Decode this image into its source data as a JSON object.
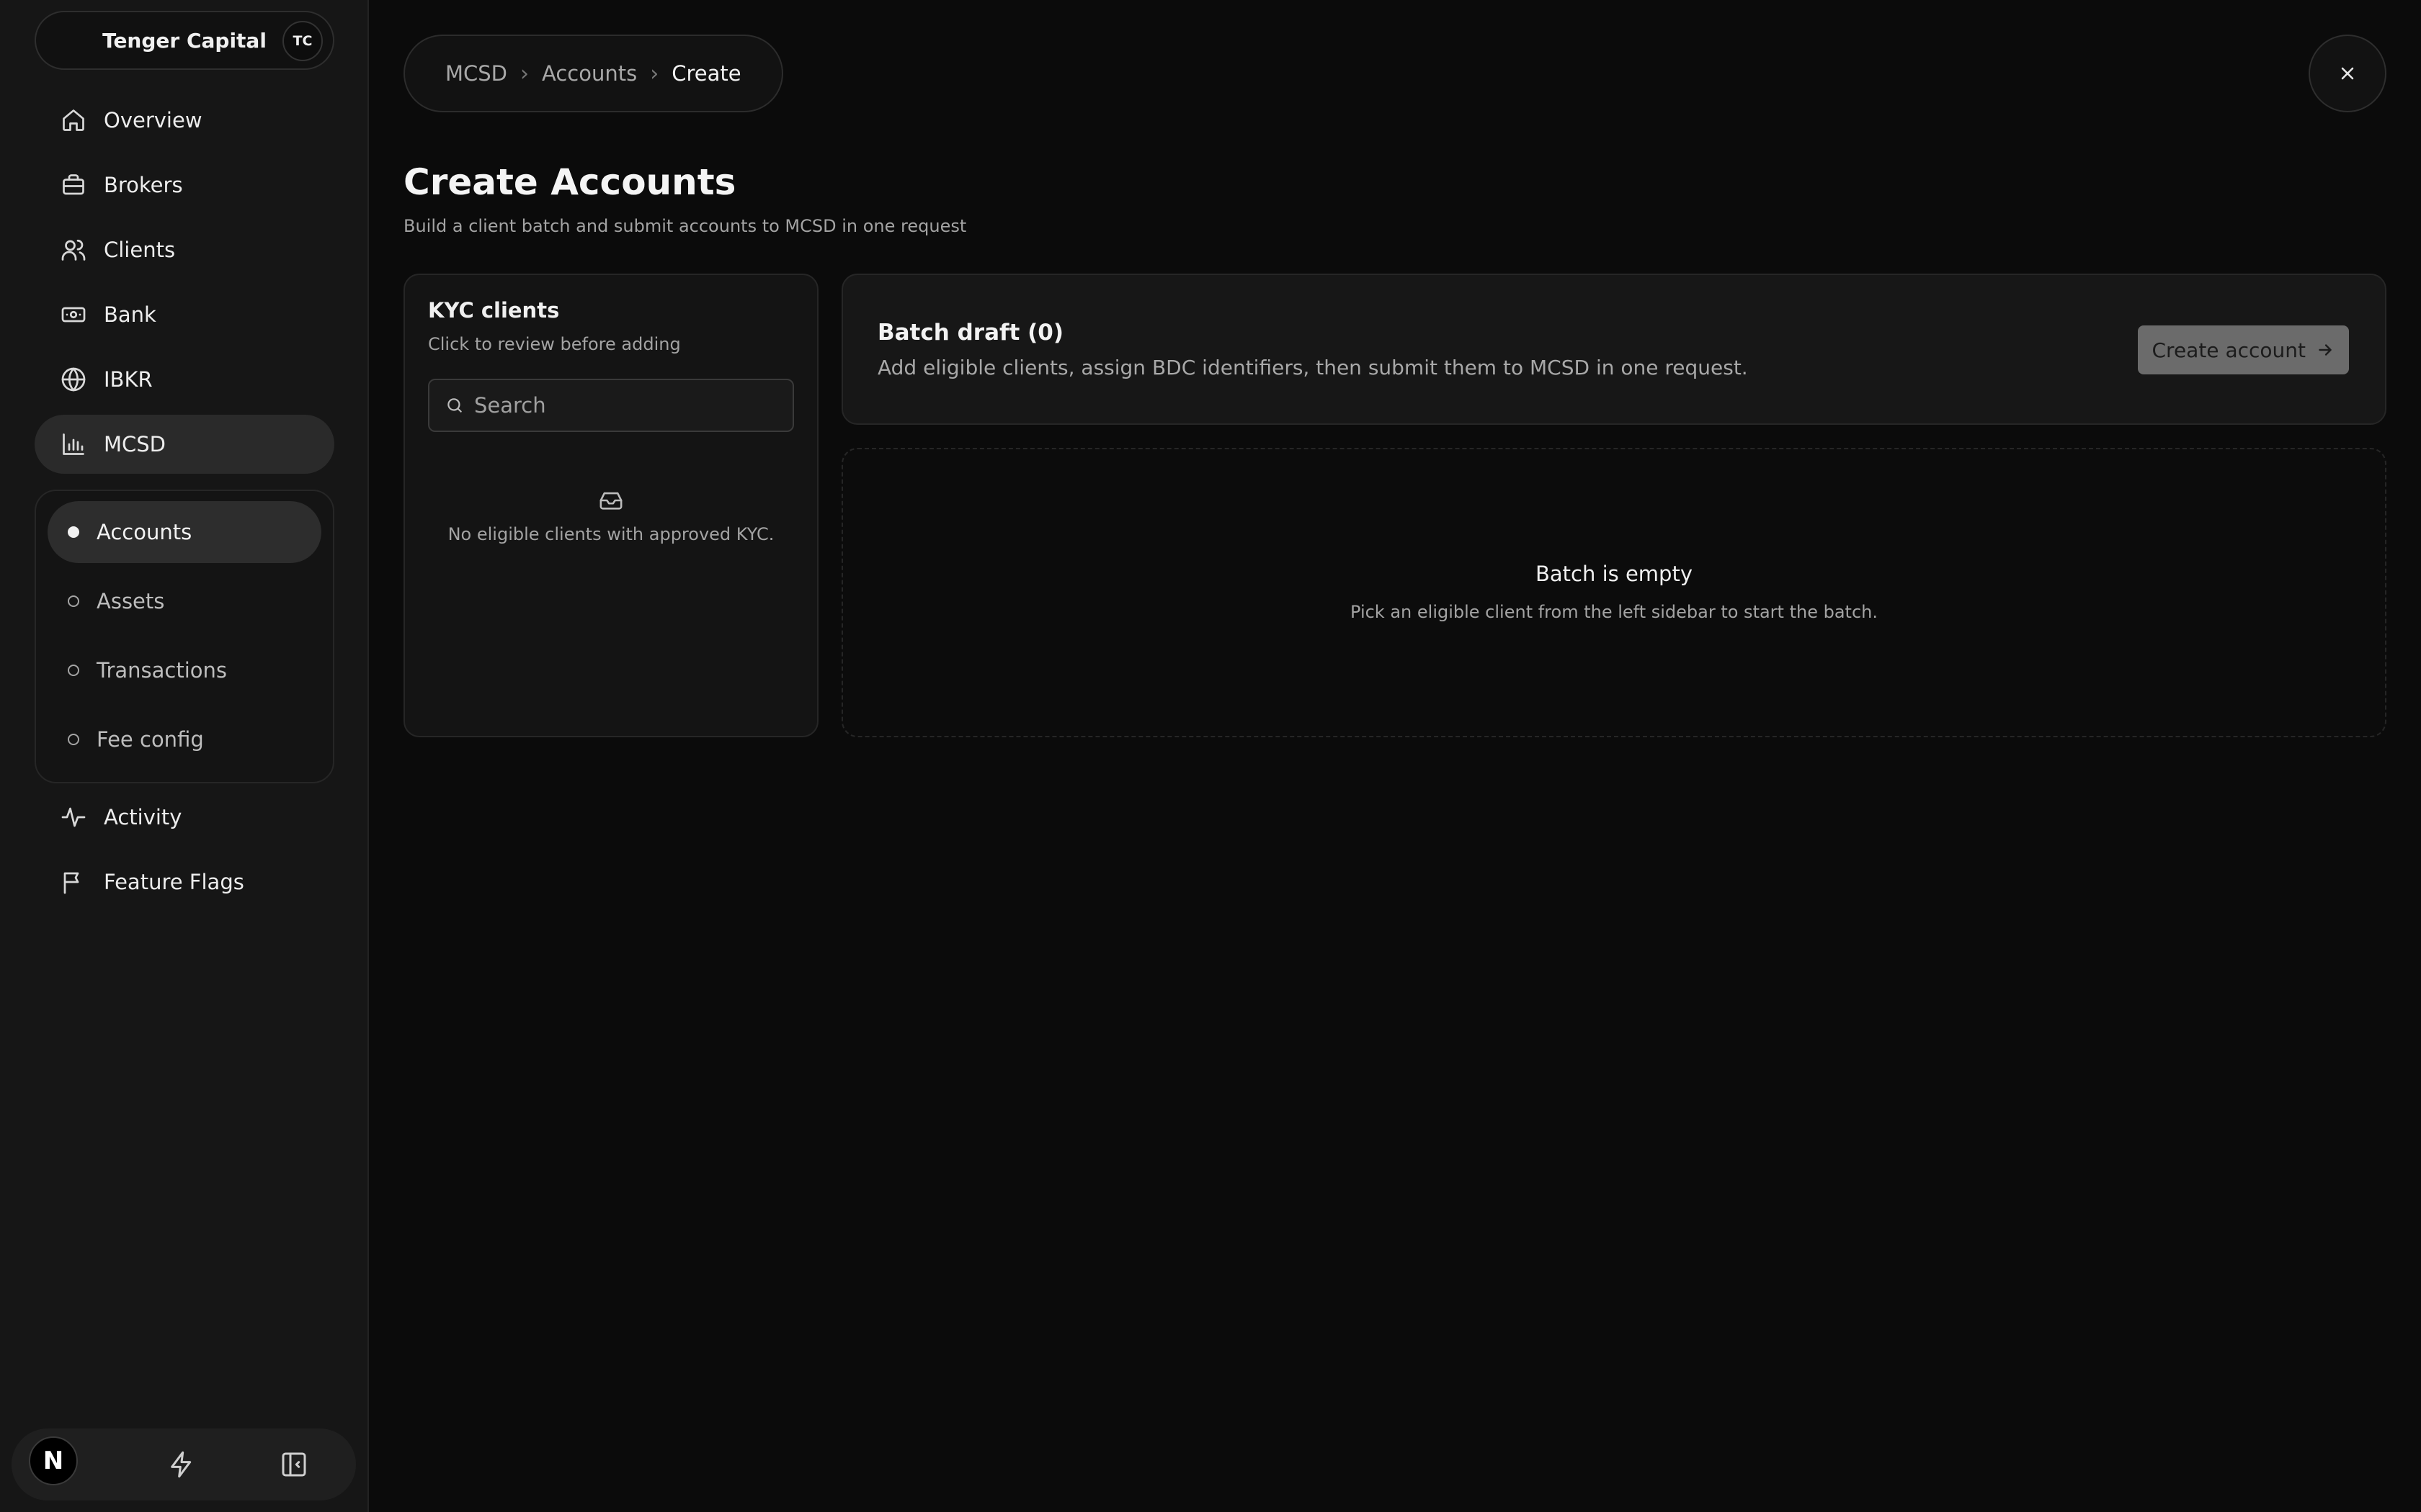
{
  "sidebar": {
    "org": {
      "name": "Tenger Capital",
      "initials": "TC"
    },
    "items": [
      {
        "label": "Overview",
        "icon": "home-icon"
      },
      {
        "label": "Brokers",
        "icon": "briefcase-icon"
      },
      {
        "label": "Clients",
        "icon": "users-icon"
      },
      {
        "label": "Bank",
        "icon": "banknote-icon"
      },
      {
        "label": "IBKR",
        "icon": "globe-icon"
      },
      {
        "label": "MCSD",
        "icon": "bar-chart-icon",
        "active": true
      }
    ],
    "mcsd_sub": [
      {
        "label": "Accounts",
        "active": true
      },
      {
        "label": "Assets"
      },
      {
        "label": "Transactions"
      },
      {
        "label": "Fee config"
      }
    ],
    "items_after": [
      {
        "label": "Activity",
        "icon": "activity-icon"
      },
      {
        "label": "Feature Flags",
        "icon": "flag-icon"
      }
    ],
    "bottom": {
      "badge": "N"
    }
  },
  "breadcrumb": [
    "MCSD",
    "Accounts",
    "Create"
  ],
  "page": {
    "title": "Create Accounts",
    "subtitle": "Build a client batch and submit accounts to MCSD in one request"
  },
  "kyc": {
    "title": "KYC clients",
    "subtitle": "Click to review before adding",
    "search_placeholder": "Search",
    "empty_text": "No eligible clients with approved KYC."
  },
  "batch": {
    "title": "Batch draft (0)",
    "description": "Add eligible clients, assign BDC identifiers, then submit them to MCSD in one request.",
    "create_label": "Create account",
    "empty_title": "Batch is empty",
    "empty_sub": "Pick an eligible client from the left sidebar to start the batch."
  },
  "colors": {
    "background": "#0b0b0b",
    "sidebar": "#161616",
    "active_pill": "#2a2a2a",
    "button_disabled": "#6b6b6b"
  }
}
